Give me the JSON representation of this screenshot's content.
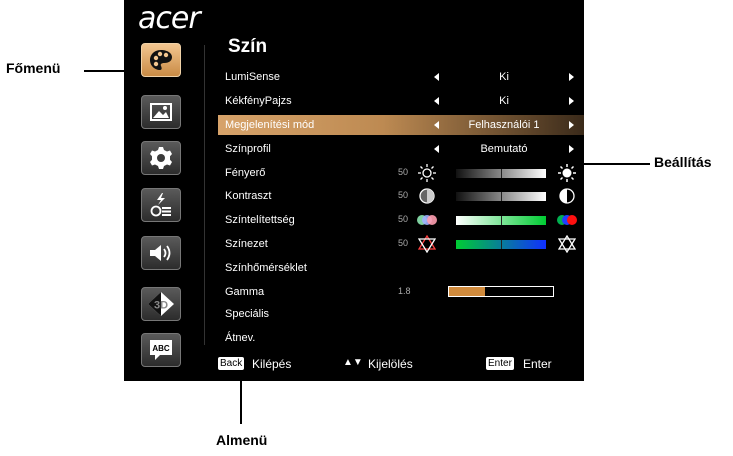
{
  "brand": "acer",
  "callouts": {
    "main_menu": "Főmenü",
    "setting": "Beállítás",
    "submenu": "Almenü"
  },
  "menu": {
    "title": "Szín"
  },
  "sidebar": [
    {
      "icon": "palette-icon",
      "active": true
    },
    {
      "icon": "image-icon",
      "active": false
    },
    {
      "icon": "gear-icon",
      "active": false
    },
    {
      "icon": "power-management-icon",
      "active": false
    },
    {
      "icon": "speaker-icon",
      "active": false
    },
    {
      "icon": "3d-icon",
      "active": false
    },
    {
      "icon": "language-icon",
      "active": false
    }
  ],
  "rows": [
    {
      "label": "LumiSense",
      "value": "Ki"
    },
    {
      "label": "KékfényPajzs",
      "value": "Ki"
    },
    {
      "label": "Megjelenítési mód",
      "value": "Felhasználói 1"
    },
    {
      "label": "Színprofil",
      "value": "Bemutató"
    },
    {
      "label": "Fényerő",
      "level": "50"
    },
    {
      "label": "Kontraszt",
      "level": "50"
    },
    {
      "label": "Színtelítettség",
      "level": "50"
    },
    {
      "label": "Színezet",
      "level": "50"
    },
    {
      "label": "Színhőmérséklet"
    },
    {
      "label": "Gamma",
      "level": "1.8",
      "fill": 0.35
    },
    {
      "label": "Speciális"
    },
    {
      "label": "Átnev."
    }
  ],
  "footer": {
    "back_key": "Back",
    "back_label": "Kilépés",
    "select_label": "Kijelölés",
    "enter_key": "Enter",
    "enter_label": "Enter"
  },
  "colors": {
    "highlight": "#d7a36a",
    "background": "#000000",
    "gamma_bar": "#d08a3c"
  }
}
